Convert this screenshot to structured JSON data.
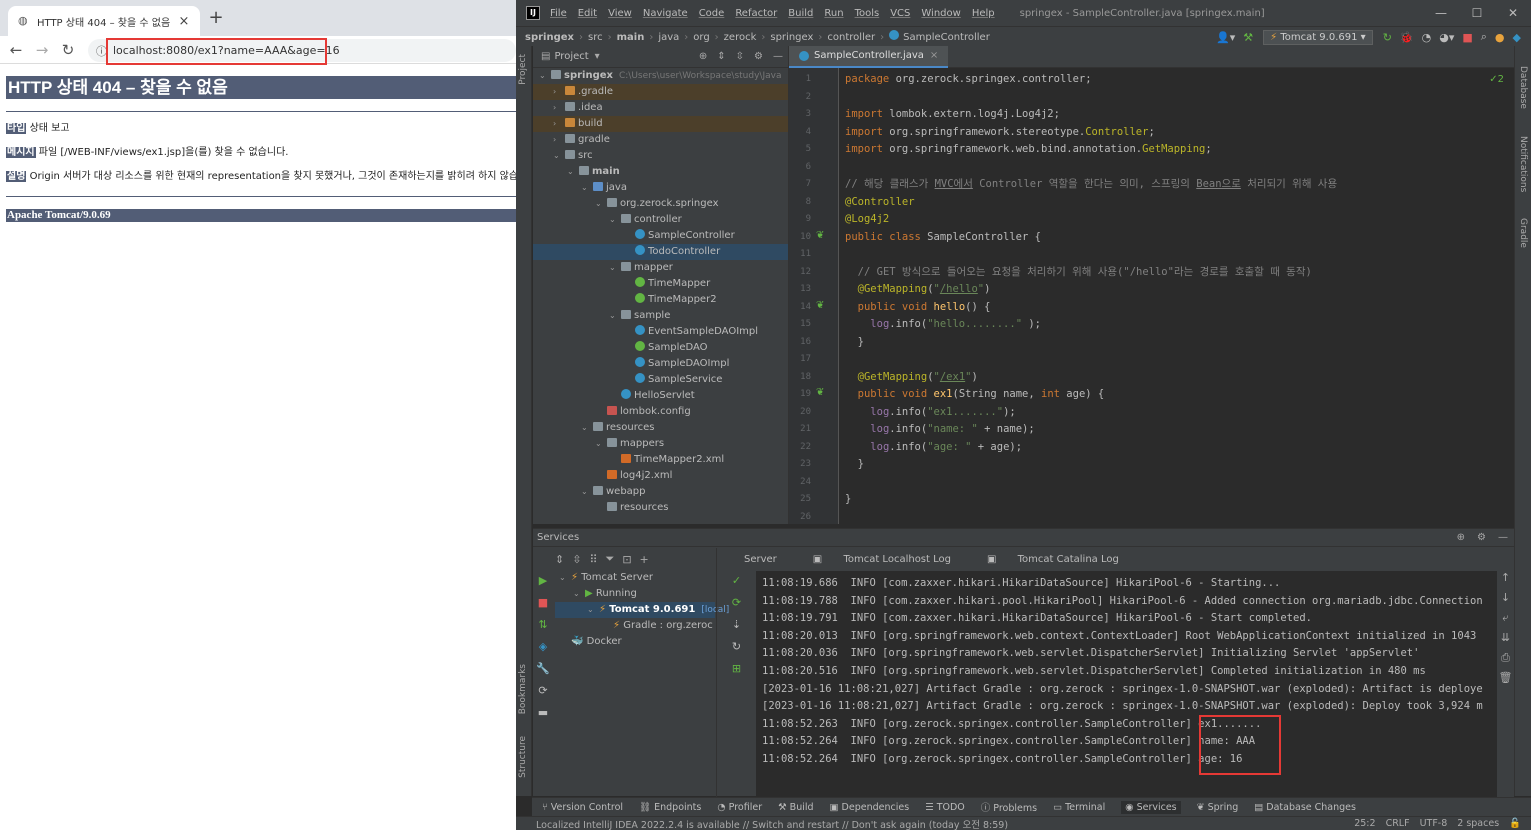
{
  "browser": {
    "tab_title": "HTTP 상태 404 – 찾을 수 없음",
    "tab_close": "×",
    "new_tab": "+",
    "back": "←",
    "forward": "→",
    "reload": "↻",
    "info_icon": "ⓘ",
    "url": "localhost:8080/ex1?name=AAA&age=16",
    "page": {
      "heading": "HTTP 상태 404 – 찾을 수 없음",
      "type_label": "타입",
      "type_value": " 상태 보고",
      "message_label": "메시지",
      "message_value": " 파일 [/WEB-INF/views/ex1.jsp]을(를) 찾을 수 없습니다.",
      "desc_label": "설명",
      "desc_value": " Origin 서버가 대상 리소스를 위한 현재의 representation을 찾지 못했거나, 그것이 존재하는지를 밝히려 하지 않습니다.",
      "footer": "Apache Tomcat/9.0.69"
    }
  },
  "ide": {
    "menu": [
      "File",
      "Edit",
      "View",
      "Navigate",
      "Code",
      "Refactor",
      "Build",
      "Run",
      "Tools",
      "VCS",
      "Window",
      "Help"
    ],
    "window_title": "springex - SampleController.java [springex.main]",
    "window_controls": [
      "—",
      "☐",
      "✕"
    ],
    "breadcrumb": [
      "springex",
      "src",
      "main",
      "java",
      "org",
      "zerock",
      "springex",
      "controller",
      "SampleController"
    ],
    "run_config": "Tomcat 9.0.691",
    "left_stripe": [
      "Project",
      "Bookmarks",
      "Structure"
    ],
    "right_stripe": [
      "Database",
      "Notifications",
      "Gradle"
    ],
    "project": {
      "header": "Project",
      "root_name": "springex",
      "root_path": "C:\\Users\\user\\Workspace\\study\\Java",
      "tree": [
        {
          "name": ".gradle",
          "depth": 1,
          "icon": "foldo",
          "arrow": "›",
          "style": "orange"
        },
        {
          "name": ".idea",
          "depth": 1,
          "icon": "fold",
          "arrow": "›",
          "style": ""
        },
        {
          "name": "build",
          "depth": 1,
          "icon": "foldo",
          "arrow": "›",
          "style": "orange"
        },
        {
          "name": "gradle",
          "depth": 1,
          "icon": "fold",
          "arrow": "›",
          "style": ""
        },
        {
          "name": "src",
          "depth": 1,
          "icon": "fold",
          "arrow": "⌄",
          "style": ""
        },
        {
          "name": "main",
          "depth": 2,
          "icon": "fold",
          "arrow": "⌄",
          "style": ""
        },
        {
          "name": "java",
          "depth": 3,
          "icon": "foldb",
          "arrow": "⌄",
          "style": ""
        },
        {
          "name": "org.zerock.springex",
          "depth": 4,
          "icon": "fold",
          "arrow": "⌄",
          "style": ""
        },
        {
          "name": "controller",
          "depth": 5,
          "icon": "fold",
          "arrow": "⌄",
          "style": ""
        },
        {
          "name": "SampleController",
          "depth": 6,
          "icon": "cls",
          "arrow": "",
          "style": ""
        },
        {
          "name": "TodoController",
          "depth": 6,
          "icon": "cls",
          "arrow": "",
          "style": "sel"
        },
        {
          "name": "mapper",
          "depth": 5,
          "icon": "fold",
          "arrow": "⌄",
          "style": ""
        },
        {
          "name": "TimeMapper",
          "depth": 6,
          "icon": "itf",
          "arrow": "",
          "style": ""
        },
        {
          "name": "TimeMapper2",
          "depth": 6,
          "icon": "itf",
          "arrow": "",
          "style": ""
        },
        {
          "name": "sample",
          "depth": 5,
          "icon": "fold",
          "arrow": "⌄",
          "style": ""
        },
        {
          "name": "EventSampleDAOImpl",
          "depth": 6,
          "icon": "cls",
          "arrow": "",
          "style": ""
        },
        {
          "name": "SampleDAO",
          "depth": 6,
          "icon": "itf",
          "arrow": "",
          "style": ""
        },
        {
          "name": "SampleDAOImpl",
          "depth": 6,
          "icon": "cls",
          "arrow": "",
          "style": ""
        },
        {
          "name": "SampleService",
          "depth": 6,
          "icon": "cls",
          "arrow": "",
          "style": ""
        },
        {
          "name": "HelloServlet",
          "depth": 5,
          "icon": "cls",
          "arrow": "",
          "style": ""
        },
        {
          "name": "lombok.config",
          "depth": 4,
          "icon": "cfg",
          "arrow": "",
          "style": ""
        },
        {
          "name": "resources",
          "depth": 3,
          "icon": "fold",
          "arrow": "⌄",
          "style": ""
        },
        {
          "name": "mappers",
          "depth": 4,
          "icon": "fold",
          "arrow": "⌄",
          "style": ""
        },
        {
          "name": "TimeMapper2.xml",
          "depth": 5,
          "icon": "xml",
          "arrow": "",
          "style": ""
        },
        {
          "name": "log4j2.xml",
          "depth": 4,
          "icon": "xml",
          "arrow": "",
          "style": ""
        },
        {
          "name": "webapp",
          "depth": 3,
          "icon": "fold",
          "arrow": "⌄",
          "style": ""
        },
        {
          "name": "resources",
          "depth": 4,
          "icon": "fold",
          "arrow": "",
          "style": ""
        }
      ]
    },
    "editor": {
      "tab": "SampleController.java",
      "corner": "✓2",
      "lines": [
        "<span class=\"kw\">package</span> org.zerock.springex.controller;",
        "",
        "<span class=\"kw\">import</span> lombok.extern.log4j.Log4j2;",
        "<span class=\"kw\">import</span> org.springframework.stereotype.<span class=\"an\">Controller</span>;",
        "<span class=\"kw\">import</span> org.springframework.web.bind.annotation.<span class=\"an\">GetMapping</span>;",
        "",
        "<span class=\"cm\">// 해당 클래스가 <span class=\"und\">MVC에서</span> Controller 역할을 한다는 의미, 스프링의 <span class=\"und\">Bean으로</span> 처리되기 위해 사용</span>",
        "<span class=\"an\">@Controller</span>",
        "<span class=\"an\">@Log4j2</span>",
        "<span class=\"kw\">public class</span> SampleController {",
        "",
        "  <span class=\"cm\">// GET 방식으로 들어오는 요청을 처리하기 위해 사용(\"/hello\"라는 경로를 호출할 때 동작)</span>",
        "  <span class=\"an\">@GetMapping</span>(<span class=\"str\">\"<span class=\"und\">/hello</span>\"</span>)",
        "  <span class=\"kw\">public void</span> <span class=\"fn\">hello</span>() {",
        "    <span class=\"lg\">log</span>.info(<span class=\"str\">\"hello........\"</span> );",
        "  }",
        "",
        "  <span class=\"an\">@GetMapping</span>(<span class=\"str\">\"<span class=\"und\">/ex1</span>\"</span>)",
        "  <span class=\"kw\">public void</span> <span class=\"fn\">ex1</span>(String name, <span class=\"kw\">int</span> age) {",
        "    <span class=\"lg\">log</span>.info(<span class=\"str\">\"ex1.......\"</span>);",
        "    <span class=\"lg\">log</span>.info(<span class=\"str\">\"name: \"</span> + name);",
        "    <span class=\"lg\">log</span>.info(<span class=\"str\">\"age: \"</span> + age);",
        "  }",
        "",
        "}",
        ""
      ]
    },
    "services": {
      "header": "Services",
      "tree": [
        {
          "name": "Tomcat Server",
          "depth": 0,
          "arrow": "⌄"
        },
        {
          "name": "Running",
          "depth": 1,
          "arrow": "⌄"
        },
        {
          "name": "Tomcat 9.0.691",
          "depth": 2,
          "arrow": "⌄",
          "extra": "[local]"
        },
        {
          "name": "Gradle : org.zeroc",
          "depth": 3,
          "arrow": ""
        },
        {
          "name": "Docker",
          "depth": 0,
          "arrow": ""
        }
      ],
      "tabs": [
        "Server",
        "Tomcat Localhost Log",
        "Tomcat Catalina Log"
      ],
      "log": [
        "11:08:19.686  INFO [com.zaxxer.hikari.HikariDataSource] HikariPool-6 - Starting...",
        "11:08:19.788  INFO [com.zaxxer.hikari.pool.HikariPool] HikariPool-6 - Added connection org.mariadb.jdbc.Connection",
        "11:08:19.791  INFO [com.zaxxer.hikari.HikariDataSource] HikariPool-6 - Start completed.",
        "11:08:20.013  INFO [org.springframework.web.context.ContextLoader] Root WebApplicationContext initialized in 1043",
        "11:08:20.036  INFO [org.springframework.web.servlet.DispatcherServlet] Initializing Servlet 'appServlet'",
        "11:08:20.516  INFO [org.springframework.web.servlet.DispatcherServlet] Completed initialization in 480 ms",
        "[2023-01-16 11:08:21,027] Artifact Gradle : org.zerock : springex-1.0-SNAPSHOT.war (exploded): Artifact is deploye",
        "[2023-01-16 11:08:21,027] Artifact Gradle : org.zerock : springex-1.0-SNAPSHOT.war (exploded): Deploy took 3,924 m",
        "11:08:52.263  INFO [org.zerock.springex.controller.SampleController] ex1.......",
        "11:08:52.264  INFO [org.zerock.springex.controller.SampleController] name: AAA",
        "11:08:52.264  INFO [org.zerock.springex.controller.SampleController] age: 16"
      ]
    },
    "bottom_tabs": [
      "Version Control",
      "Endpoints",
      "Profiler",
      "Build",
      "Dependencies",
      "TODO",
      "Problems",
      "Terminal",
      "Services",
      "Spring",
      "Database Changes"
    ],
    "active_bottom_tab": "Services",
    "status_left": "Localized IntelliJ IDEA 2022.2.4 is available // Switch and restart // Don't ask again (today 오전 8:59)",
    "status_right": [
      "25:2",
      "CRLF",
      "UTF-8",
      "2 spaces"
    ]
  }
}
